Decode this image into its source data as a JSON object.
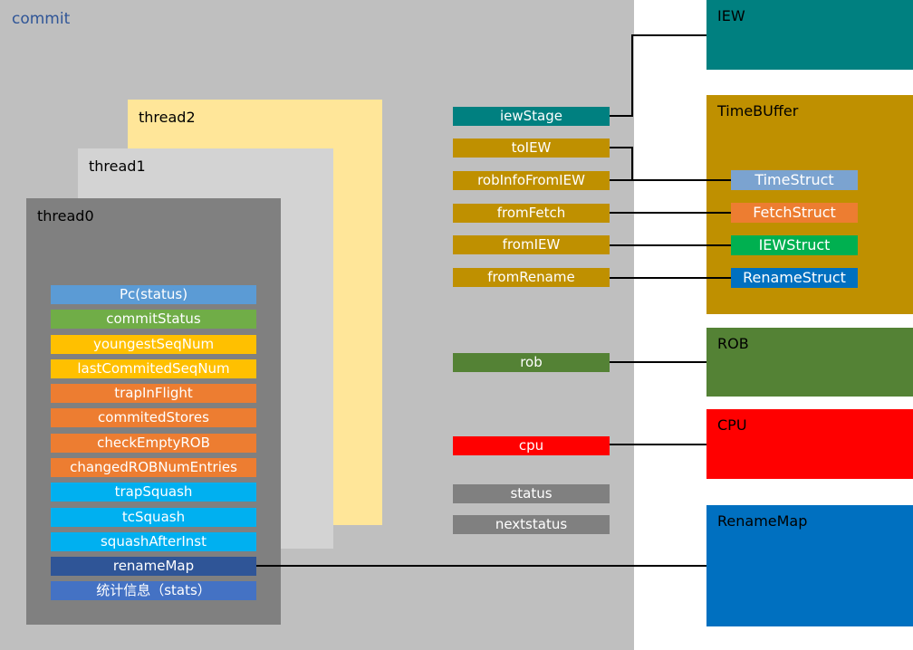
{
  "commit": {
    "label": "commit"
  },
  "threads": [
    {
      "label": "thread2"
    },
    {
      "label": "thread1"
    },
    {
      "label": "thread0"
    }
  ],
  "thread_fields": [
    {
      "label": "Pc(status)",
      "color": "#5b9bd5"
    },
    {
      "label": "commitStatus",
      "color": "#70ad47"
    },
    {
      "label": "youngestSeqNum",
      "color": "#ffc000"
    },
    {
      "label": "lastCommitedSeqNum",
      "color": "#ffc000"
    },
    {
      "label": "trapInFlight",
      "color": "#ed7d31"
    },
    {
      "label": "commitedStores",
      "color": "#ed7d31"
    },
    {
      "label": "checkEmptyROB",
      "color": "#ed7d31"
    },
    {
      "label": "changedROBNumEntries",
      "color": "#ed7d31"
    },
    {
      "label": "trapSquash",
      "color": "#00b0f0"
    },
    {
      "label": "tcSquash",
      "color": "#00b0f0"
    },
    {
      "label": "squashAfterInst",
      "color": "#00b0f0"
    },
    {
      "label": "renameMap",
      "color": "#2f5597"
    },
    {
      "label": "统计信息（stats）",
      "color": "#4472c4"
    }
  ],
  "commit_fields": [
    {
      "label": "iewStage",
      "color": "#008080"
    },
    {
      "label": "toIEW",
      "color": "#bf9000"
    },
    {
      "label": "robInfoFromIEW",
      "color": "#bf9000"
    },
    {
      "label": "fromFetch",
      "color": "#bf9000"
    },
    {
      "label": "fromIEW",
      "color": "#bf9000"
    },
    {
      "label": "fromRename",
      "color": "#bf9000"
    },
    {
      "label": "rob",
      "color": "#548235"
    },
    {
      "label": "cpu",
      "color": "#ff0000"
    },
    {
      "label": "status",
      "color": "#808080"
    },
    {
      "label": "nextstatus",
      "color": "#808080"
    }
  ],
  "external": [
    {
      "label": "IEW",
      "color": "#008080"
    },
    {
      "label": "TimeBUffer",
      "color": "#bf9000"
    },
    {
      "label": "ROB",
      "color": "#548235"
    },
    {
      "label": "CPU",
      "color": "#ff0000"
    },
    {
      "label": "RenameMap",
      "color": "#0070c0"
    }
  ],
  "structs": [
    {
      "label": "TimeStruct",
      "color": "#7ba3d0"
    },
    {
      "label": "FetchStruct",
      "color": "#ed7d31"
    },
    {
      "label": "IEWStruct",
      "color": "#00b050"
    },
    {
      "label": "RenameStruct",
      "color": "#0070c0"
    }
  ]
}
